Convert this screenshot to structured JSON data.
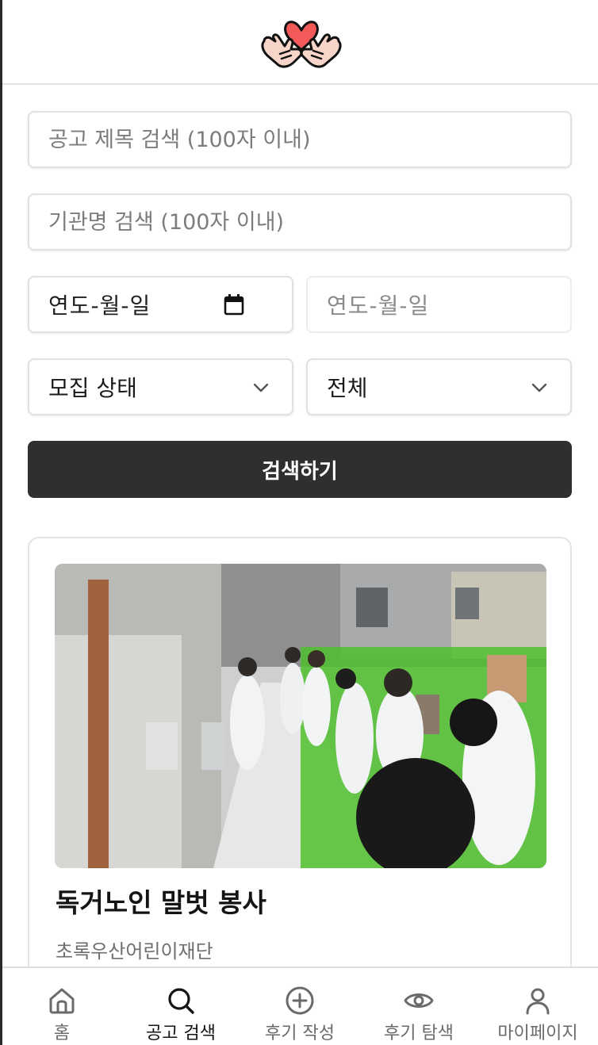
{
  "header": {
    "logo": "heart-hands-logo"
  },
  "search": {
    "title_placeholder": "공고 제목 검색 (100자 이내)",
    "org_placeholder": "기관명 검색 (100자 이내)",
    "start_date": "연도-월-일",
    "end_date": "연도-월-일",
    "status_select": "모집 상태",
    "category_select": "전체",
    "submit_label": "검색하기"
  },
  "results": [
    {
      "title": "독거노인 말벗 봉사",
      "organization": "초록우산어린이재단"
    }
  ],
  "nav": {
    "items": [
      {
        "label": "홈",
        "icon": "home-icon",
        "active": false
      },
      {
        "label": "공고 검색",
        "icon": "search-icon",
        "active": true
      },
      {
        "label": "후기 작성",
        "icon": "plus-circle-icon",
        "active": false
      },
      {
        "label": "후기 탐색",
        "icon": "eye-icon",
        "active": false
      },
      {
        "label": "마이페이지",
        "icon": "user-icon",
        "active": false
      }
    ]
  },
  "colors": {
    "primary_button": "#2f2f31",
    "logo_heart": "#f25a5a",
    "border": "#e1e1e1"
  }
}
